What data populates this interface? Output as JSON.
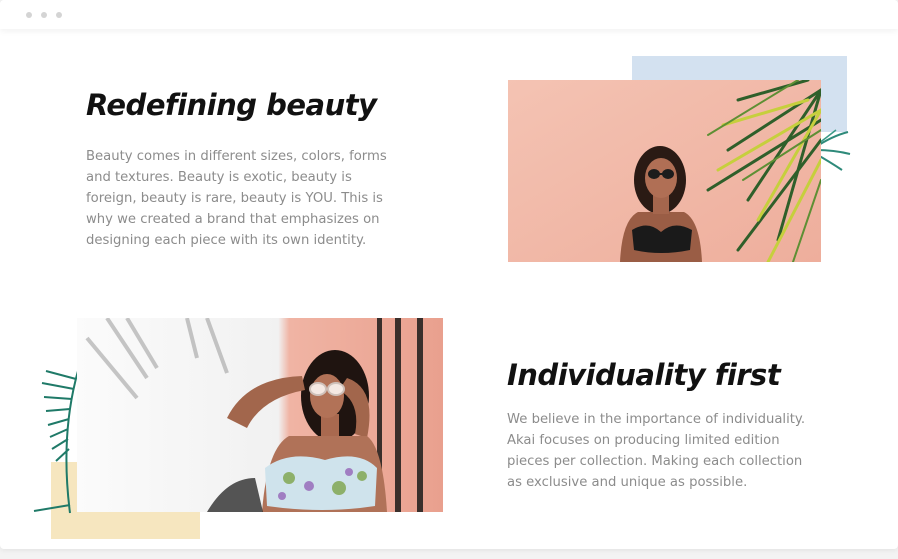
{
  "colors": {
    "accent_blue": "#d3e1f0",
    "accent_cream": "#f6e6bf",
    "heading": "#111111",
    "body_text": "#8c8c8c",
    "peach_wall": "#f2b9a8"
  },
  "section1": {
    "heading": "Redefining beauty",
    "body": "Beauty comes in different sizes, colors, forms and textures. Beauty is exotic, beauty is foreign, beauty is rare, beauty is YOU. This is why we created a brand that emphasizes on designing each piece with its own identity."
  },
  "section2": {
    "heading": "Individuality first",
    "body": "We believe in the importance of individuality. Akai focuses on producing limited edition pieces per collection. Making each collection as exclusive and unique as possible."
  }
}
